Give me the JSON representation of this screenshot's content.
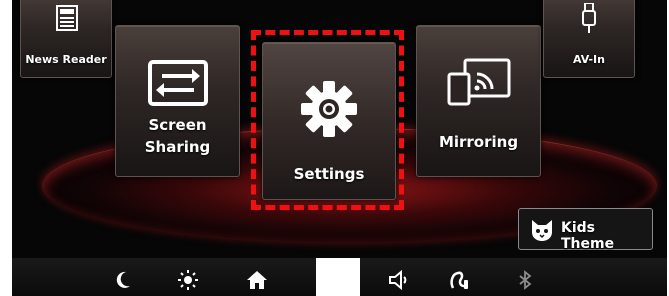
{
  "tiles": {
    "news_reader": "News Reader",
    "screen_sharing_line1": "Screen",
    "screen_sharing_line2": "Sharing",
    "settings": "Settings",
    "mirroring": "Mirroring",
    "av_in": "AV-In",
    "kids_theme": "Kids Theme"
  },
  "icons": {
    "news_reader": "newspaper-icon",
    "screen_sharing": "swap-arrows-icon",
    "settings": "gear-icon",
    "mirroring": "cast-icon",
    "av_in": "usb-cable-icon",
    "kids_theme": "cat-face-icon"
  },
  "bottom_bar": [
    "moon-icon",
    "brightness-icon",
    "home-icon",
    "volume-icon",
    "hands-free-icon",
    "bluetooth-icon"
  ],
  "colors": {
    "selection_outline": "#ee1111",
    "accent_glow": "#c81e1e"
  }
}
